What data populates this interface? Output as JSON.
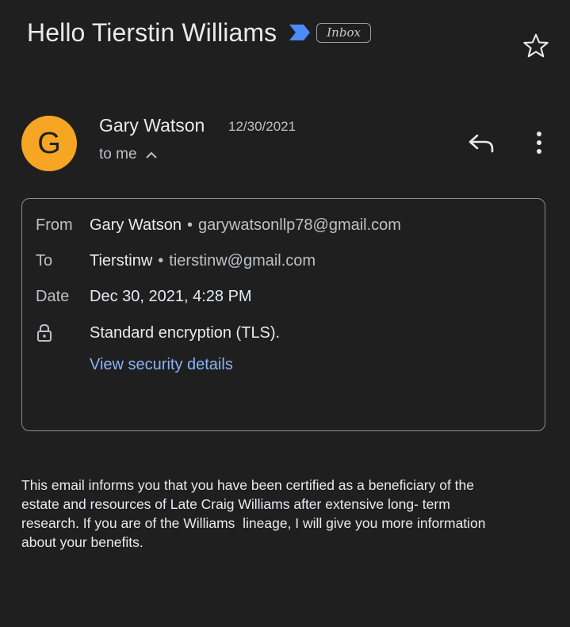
{
  "header": {
    "subject": "Hello Tierstin Williams",
    "label": "Inbox",
    "importance_color": "#4c8bf5"
  },
  "sender": {
    "avatar_initial": "G",
    "avatar_color": "#f6a623",
    "name": "Gary Watson",
    "date": "12/30/2021",
    "recipient_summary": "to me"
  },
  "details": {
    "from_label": "From",
    "from_name": "Gary Watson",
    "from_email": "garywatsonllp78@gmail.com",
    "to_label": "To",
    "to_name": "Tierstinw",
    "to_email": "tierstinw@gmail.com",
    "date_label": "Date",
    "date_value": "Dec 30, 2021, 4:28 PM",
    "encryption": "Standard encryption (TLS).",
    "security_link": "View security details",
    "separator": "•"
  },
  "body": {
    "text": "This email informs you that you have been certified as a beneficiary of the\nestate and resources of Late Craig Williams after extensive long- term\nresearch. If you are of the Williams  lineage, I will give you more information\nabout your benefits."
  },
  "icons": {
    "importance": "importance-marker-icon",
    "star": "star-icon",
    "reply": "reply-icon",
    "more": "more-vert-icon",
    "expand": "chevron-up-icon",
    "lock": "lock-icon"
  },
  "colors": {
    "background": "#1f1f1f",
    "link": "#8ab4f8"
  }
}
